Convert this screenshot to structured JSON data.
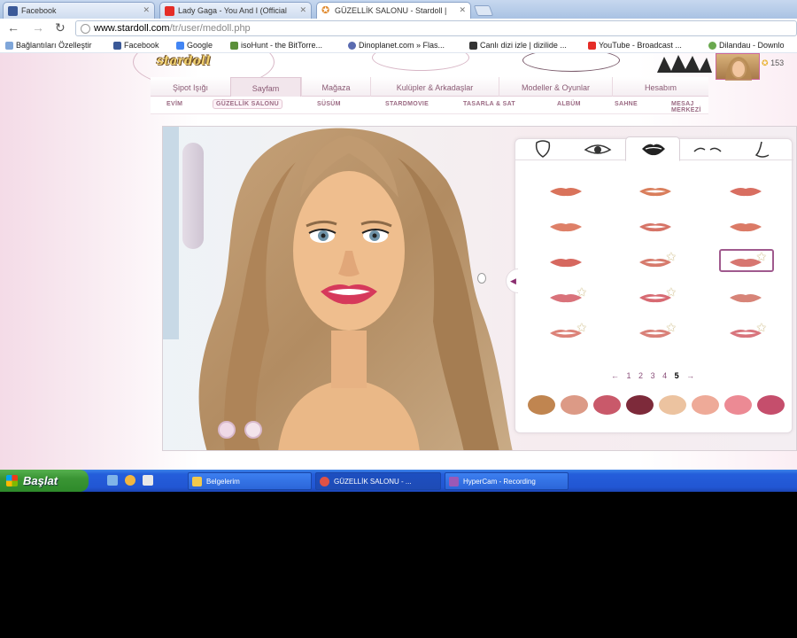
{
  "browser": {
    "tabs": [
      {
        "label": "Facebook",
        "icon": "facebook-icon",
        "color": "#3b5998"
      },
      {
        "label": "Lady Gaga - You And I (Official",
        "icon": "youtube-icon",
        "color": "#e52d27"
      },
      {
        "label": "GÜZELLİK SALONU - Stardoll |",
        "icon": "star-icon",
        "color": "#e08a2e"
      }
    ],
    "url_host": "www.stardoll.com",
    "url_path": "/tr/user/medoll.php",
    "bookmarks": [
      {
        "label": "Bağlantıları Özelleştir",
        "icon": "globe-icon",
        "color": "#7fa6d9"
      },
      {
        "label": "Facebook",
        "icon": "facebook-icon",
        "color": "#3b5998"
      },
      {
        "label": "Google",
        "icon": "google-icon",
        "color": "#4285f4"
      },
      {
        "label": "isoHunt - the BitTorre...",
        "icon": "isohunt-icon",
        "color": "#5b8f3a"
      },
      {
        "label": "Dinoplanet.com » Flas...",
        "icon": "dinoplanet-icon",
        "color": "#5a6bb0"
      },
      {
        "label": "Canlı dizi izle | dizilide ...",
        "icon": "dizi-icon",
        "color": "#333333"
      },
      {
        "label": "YouTube - Broadcast ...",
        "icon": "youtube-icon",
        "color": "#e52d27"
      },
      {
        "label": "Dilandau - Downlo",
        "icon": "dilandau-icon",
        "color": "#6aa84f"
      }
    ]
  },
  "site": {
    "logo": "stardoll",
    "star_count": "153",
    "main_nav": [
      "Şipot Işığı",
      "Sayfam",
      "Mağaza",
      "Kulüpler & Arkadaşlar",
      "Modeller & Oyunlar",
      "Hesabım"
    ],
    "main_nav_active": 1,
    "sub_nav": [
      "EVİM",
      "GÜZELLİK SALONU",
      "SÜSÜM",
      "STARDMOVIE",
      "TASARLA & SAT",
      "ALBÜM",
      "SAHNE",
      "MESAJ MERKEZİ"
    ],
    "sub_nav_active": 1
  },
  "beauty": {
    "categories": [
      "face-shape-icon",
      "eye-icon",
      "lips-icon",
      "eyebrow-icon",
      "nose-icon"
    ],
    "active_category": 2,
    "pages": [
      "1",
      "2",
      "3",
      "4",
      "5"
    ],
    "current_page": "5",
    "pager_prev": "←",
    "pager_next": "→",
    "selected_lip": 8,
    "lip_starred": [
      false,
      false,
      false,
      false,
      false,
      false,
      false,
      true,
      true,
      true,
      true,
      false,
      true,
      true,
      true
    ],
    "swatches": [
      "#c08550",
      "#dc9a86",
      "#c9596a",
      "#7d2a3a",
      "#ecc3a0",
      "#eeaa98",
      "#ec8a94",
      "#c54e6c"
    ]
  },
  "taskbar": {
    "start_label": "Başlat",
    "items": [
      {
        "label": "Belgelerim",
        "icon": "folder-icon",
        "color": "#f2c94c"
      },
      {
        "label": "GÜZELLİK SALONU - ...",
        "icon": "chrome-icon",
        "color": "#de5246"
      },
      {
        "label": "HyperCam - Recording",
        "icon": "hypercam-icon",
        "color": "#9b59b6"
      }
    ]
  }
}
